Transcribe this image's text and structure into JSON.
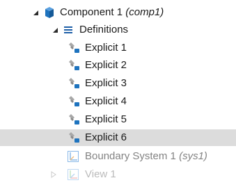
{
  "tree": {
    "component": {
      "label": "Component 1",
      "tag": "(comp1)",
      "icon": "component-cube-icon",
      "expanded": true
    },
    "definitions": {
      "label": "Definitions",
      "icon": "definitions-list-icon",
      "expanded": true
    },
    "selections": [
      {
        "label": "Explicit 1",
        "icon": "explicit-selection-icon"
      },
      {
        "label": "Explicit 2",
        "icon": "explicit-selection-icon"
      },
      {
        "label": "Explicit 3",
        "icon": "explicit-selection-icon"
      },
      {
        "label": "Explicit 4",
        "icon": "explicit-selection-icon"
      },
      {
        "label": "Explicit 5",
        "icon": "explicit-selection-icon"
      },
      {
        "label": "Explicit 6",
        "icon": "explicit-selection-icon",
        "selected": true
      }
    ],
    "boundary_system": {
      "label": "Boundary System 1",
      "tag": "(sys1)",
      "icon": "boundary-system-icon"
    },
    "view": {
      "label": "View 1",
      "icon": "view-icon",
      "expanded": false
    }
  },
  "colors": {
    "selection_bg": "#dcdcdc",
    "cube_blue": "#1e73be",
    "list_blue": "#1e5fa8",
    "axes_blue": "#2a7fd4",
    "text": "#1a1a1a"
  }
}
